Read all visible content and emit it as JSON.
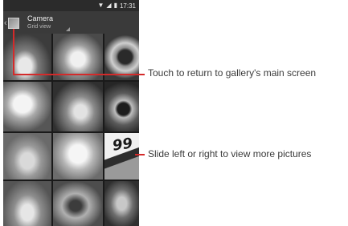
{
  "statusbar": {
    "wifi_icon": "wifi-icon",
    "alarm_icon": "alarm-icon",
    "battery_icon": "battery-icon",
    "time": "17:31"
  },
  "actionbar": {
    "title": "Camera",
    "subtitle": "Grid view",
    "back_icon": "chevron-left-icon",
    "album_icon": "album-thumbnail-icon"
  },
  "grid": {
    "tile_8_text": "99"
  },
  "callouts": {
    "back": "Touch to return to gallery's main screen",
    "swipe": "Slide left or right to view more pictures"
  },
  "colors": {
    "callout_line": "#d42a2a",
    "actionbar_bg": "#3a3a3a",
    "statusbar_bg": "#2b2b2b"
  }
}
